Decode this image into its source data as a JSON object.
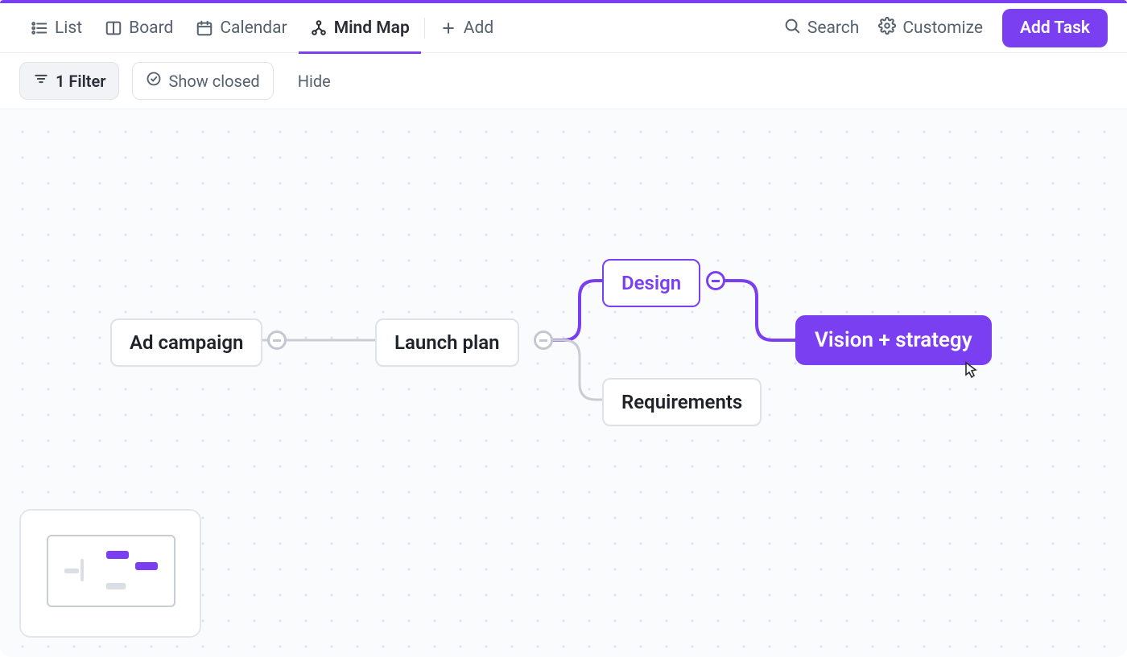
{
  "views": {
    "list": "List",
    "board": "Board",
    "calendar": "Calendar",
    "mindmap": "Mind Map",
    "add": "Add",
    "active": "mindmap"
  },
  "header": {
    "search": "Search",
    "customize": "Customize",
    "add_task": "Add Task"
  },
  "filters": {
    "filter_chip": "1 Filter",
    "show_closed": "Show closed",
    "hide": "Hide"
  },
  "nodes": {
    "ad_campaign": "Ad campaign",
    "launch_plan": "Launch plan",
    "design": "Design",
    "requirements": "Requirements",
    "vision_strategy": "Vision + strategy"
  },
  "colors": {
    "accent": "#7B3FF2"
  }
}
